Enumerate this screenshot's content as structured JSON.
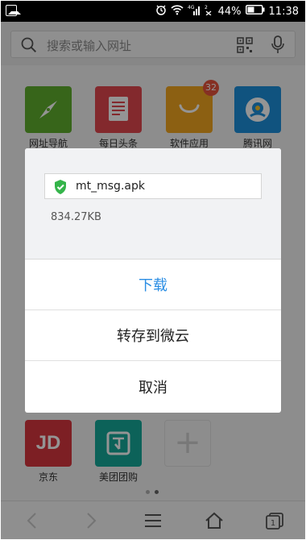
{
  "status_bar": {
    "battery": "44%",
    "time": "11:38"
  },
  "search": {
    "placeholder": "搜索或输入网址"
  },
  "apps": [
    {
      "label": "网址导航",
      "icon": "compass-icon",
      "color": "#5fae2e"
    },
    {
      "label": "每日头条",
      "icon": "news-icon",
      "color": "#e2474f"
    },
    {
      "label": "软件应用",
      "icon": "bag-icon",
      "color": "#f1a51f",
      "badge": "32"
    },
    {
      "label": "腾讯网",
      "icon": "tencent-icon",
      "color": "#1d8fdb"
    },
    {
      "label": "京东",
      "icon": "jd-icon",
      "color": "#d8363f",
      "text": "JD"
    },
    {
      "label": "美团团购",
      "icon": "meituan-icon",
      "color": "#16a99a"
    }
  ],
  "dialog": {
    "file_name": "mt_msg.apk",
    "file_size": "834.27KB",
    "download": "下载",
    "save_to_cloud": "转存到微云",
    "cancel": "取消"
  },
  "nav": {
    "tab_count": "1"
  },
  "colors": {
    "accent": "#2b8ee4",
    "shield": "#34b44a"
  }
}
